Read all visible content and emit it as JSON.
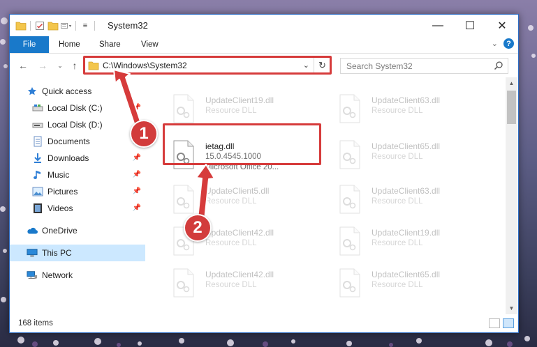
{
  "window": {
    "title": "System32"
  },
  "ribbon": {
    "tabs": [
      "File",
      "Home",
      "Share",
      "View"
    ],
    "help_label": "?"
  },
  "nav": {
    "back_icon": "back-arrow-icon",
    "forward_icon": "forward-arrow-icon",
    "recent_icon": "chevron-down-icon",
    "up_icon": "up-arrow-icon",
    "address_path": "C:\\Windows\\System32",
    "search_placeholder": "Search System32"
  },
  "sidebar": {
    "items": [
      {
        "label": "Quick access",
        "icon": "star-icon",
        "pinned": false
      },
      {
        "label": "Local Disk (C:)",
        "icon": "drive-icon",
        "pinned": true
      },
      {
        "label": "Local Disk (D:)",
        "icon": "drive-icon",
        "pinned": false
      },
      {
        "label": "Documents",
        "icon": "documents-icon",
        "pinned": true
      },
      {
        "label": "Downloads",
        "icon": "download-icon",
        "pinned": true
      },
      {
        "label": "Music",
        "icon": "music-icon",
        "pinned": true
      },
      {
        "label": "Pictures",
        "icon": "pictures-icon",
        "pinned": true
      },
      {
        "label": "Videos",
        "icon": "videos-icon",
        "pinned": true
      },
      {
        "label": "OneDrive",
        "icon": "cloud-icon",
        "pinned": false
      },
      {
        "label": "This PC",
        "icon": "computer-icon",
        "pinned": false,
        "selected": true
      },
      {
        "label": "Network",
        "icon": "network-icon",
        "pinned": false
      }
    ]
  },
  "files": [
    {
      "name": "UpdateClient19.dll",
      "line2": "Resource DLL",
      "line3": "",
      "faded": true
    },
    {
      "name": "UpdateClient63.dll",
      "line2": "Resource DLL",
      "line3": "",
      "faded": true
    },
    {
      "name": "ietag.dll",
      "line2": "15.0.4545.1000",
      "line3": "Microsoft Office 20...",
      "faded": false
    },
    {
      "name": "UpdateClient65.dll",
      "line2": "Resource DLL",
      "line3": "",
      "faded": true
    },
    {
      "name": "UpdateClient5.dll",
      "line2": "Resource DLL",
      "line3": "",
      "faded": true
    },
    {
      "name": "UpdateClient63.dll",
      "line2": "Resource DLL",
      "line3": "",
      "faded": true
    },
    {
      "name": "UpdateClient42.dll",
      "line2": "Resource DLL",
      "line3": "",
      "faded": true
    },
    {
      "name": "UpdateClient19.dll",
      "line2": "Resource DLL",
      "line3": "",
      "faded": true
    },
    {
      "name": "UpdateClient42.dll",
      "line2": "Resource DLL",
      "line3": "",
      "faded": true
    },
    {
      "name": "UpdateClient65.dll",
      "line2": "Resource DLL",
      "line3": "",
      "faded": true
    }
  ],
  "status": {
    "item_count": "168 items"
  },
  "annotations": {
    "step1": "1",
    "step2": "2",
    "color": "#d63b3b"
  },
  "colors": {
    "accent": "#1979ca",
    "selection": "#cce8ff",
    "highlight": "#d63b3b"
  }
}
